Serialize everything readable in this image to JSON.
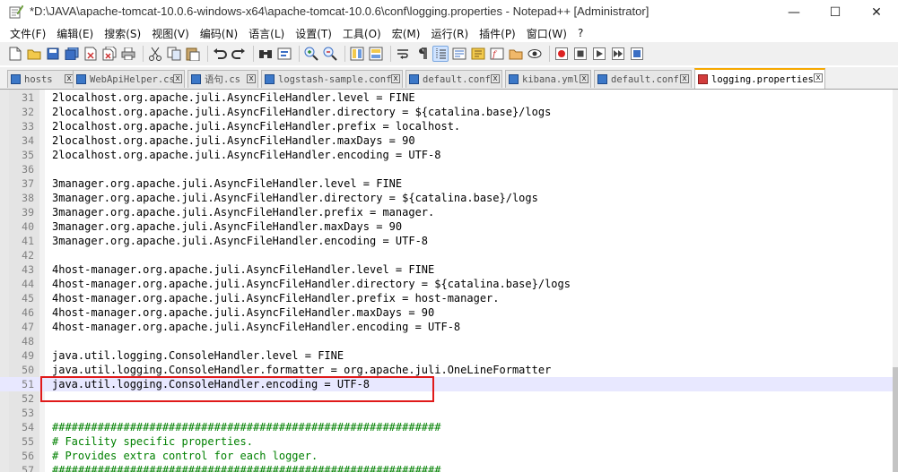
{
  "window": {
    "title": "*D:\\JAVA\\apache-tomcat-10.0.6-windows-x64\\apache-tomcat-10.0.6\\conf\\logging.properties - Notepad++ [Administrator]",
    "app_icon": "notepadpp-icon",
    "minimize": "—",
    "maximize": "☐",
    "close": "✕"
  },
  "menu": [
    "文件(F)",
    "编辑(E)",
    "搜索(S)",
    "视图(V)",
    "编码(N)",
    "语言(L)",
    "设置(T)",
    "工具(O)",
    "宏(M)",
    "运行(R)",
    "插件(P)",
    "窗口(W)",
    "?"
  ],
  "toolbar": {
    "icons": [
      "new-file-icon",
      "open-file-icon",
      "save-icon",
      "save-all-icon",
      "close-icon",
      "close-all-icon",
      "print-icon",
      "cut-icon",
      "copy-icon",
      "paste-icon",
      "undo-icon",
      "redo-icon",
      "find-icon",
      "replace-icon",
      "zoom-in-icon",
      "zoom-out-icon",
      "sync-vertical-icon",
      "sync-horizontal-icon",
      "word-wrap-icon",
      "show-all-chars-icon",
      "indent-guide-icon",
      "udl-icon",
      "doc-map-icon",
      "function-list-icon",
      "folder-workspace-icon",
      "monitor-icon",
      "record-macro-icon",
      "stop-record-icon",
      "play-macro-icon",
      "run-macro-multiple-icon",
      "save-macro-icon"
    ]
  },
  "tabs": [
    {
      "label": "hosts",
      "active": false
    },
    {
      "label": "WebApiHelper.cs",
      "active": false
    },
    {
      "label": "语句.cs",
      "active": false
    },
    {
      "label": "logstash-sample.conf",
      "active": false
    },
    {
      "label": "default.conf",
      "active": false
    },
    {
      "label": "kibana.yml",
      "active": false
    },
    {
      "label": "default.conf",
      "active": false
    },
    {
      "label": "logging.properties",
      "active": true
    }
  ],
  "tab_close_glyph": "x",
  "editor": {
    "current_line": 51,
    "lines": [
      {
        "n": "31",
        "text": "2localhost.org.apache.juli.AsyncFileHandler.level = FINE"
      },
      {
        "n": "32",
        "text": "2localhost.org.apache.juli.AsyncFileHandler.directory = ${catalina.base}/logs"
      },
      {
        "n": "33",
        "text": "2localhost.org.apache.juli.AsyncFileHandler.prefix = localhost."
      },
      {
        "n": "34",
        "text": "2localhost.org.apache.juli.AsyncFileHandler.maxDays = 90"
      },
      {
        "n": "35",
        "text": "2localhost.org.apache.juli.AsyncFileHandler.encoding = UTF-8"
      },
      {
        "n": "36",
        "text": ""
      },
      {
        "n": "37",
        "text": "3manager.org.apache.juli.AsyncFileHandler.level = FINE"
      },
      {
        "n": "38",
        "text": "3manager.org.apache.juli.AsyncFileHandler.directory = ${catalina.base}/logs"
      },
      {
        "n": "39",
        "text": "3manager.org.apache.juli.AsyncFileHandler.prefix = manager."
      },
      {
        "n": "40",
        "text": "3manager.org.apache.juli.AsyncFileHandler.maxDays = 90"
      },
      {
        "n": "41",
        "text": "3manager.org.apache.juli.AsyncFileHandler.encoding = UTF-8"
      },
      {
        "n": "42",
        "text": ""
      },
      {
        "n": "43",
        "text": "4host-manager.org.apache.juli.AsyncFileHandler.level = FINE"
      },
      {
        "n": "44",
        "text": "4host-manager.org.apache.juli.AsyncFileHandler.directory = ${catalina.base}/logs"
      },
      {
        "n": "45",
        "text": "4host-manager.org.apache.juli.AsyncFileHandler.prefix = host-manager."
      },
      {
        "n": "46",
        "text": "4host-manager.org.apache.juli.AsyncFileHandler.maxDays = 90"
      },
      {
        "n": "47",
        "text": "4host-manager.org.apache.juli.AsyncFileHandler.encoding = UTF-8"
      },
      {
        "n": "48",
        "text": ""
      },
      {
        "n": "49",
        "text": "java.util.logging.ConsoleHandler.level = FINE"
      },
      {
        "n": "50",
        "text": "java.util.logging.ConsoleHandler.formatter = org.apache.juli.OneLineFormatter"
      },
      {
        "n": "51",
        "text": "java.util.logging.ConsoleHandler.encoding = UTF-8"
      },
      {
        "n": "52",
        "text": ""
      },
      {
        "n": "53",
        "text": ""
      },
      {
        "n": "54",
        "text": "############################################################",
        "kind": "comment"
      },
      {
        "n": "55",
        "text": "# Facility specific properties.",
        "kind": "comment"
      },
      {
        "n": "56",
        "text": "# Provides extra control for each logger.",
        "kind": "comment"
      },
      {
        "n": "57",
        "text": "############################################################",
        "kind": "comment"
      }
    ]
  },
  "colors": {
    "highlight_box": "#e01a1a",
    "active_tab_accent": "#f6a800",
    "current_line_bg": "#e8e8ff",
    "comment": "#008000"
  }
}
